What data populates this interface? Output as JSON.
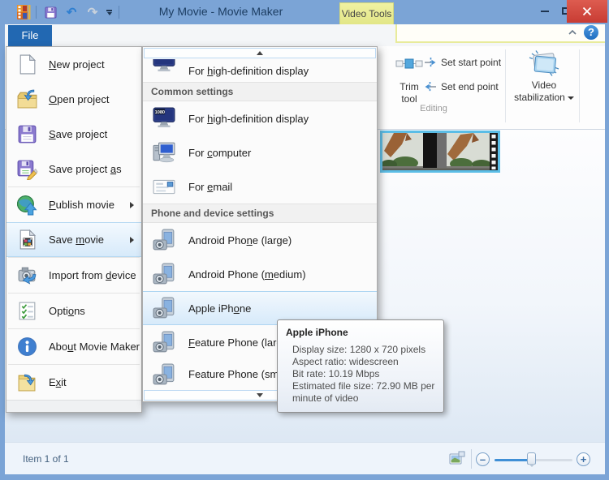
{
  "window": {
    "title": "My Movie - Movie Maker",
    "file_tab": "File",
    "contextual_tab": "Video Tools"
  },
  "icons": {
    "undo": "↶",
    "redo": "↷",
    "help": "?",
    "hd_badge": "1080",
    "zoom_out": "–",
    "zoom_in": "+"
  },
  "ribbon": {
    "trim_tool": "Trim tool",
    "set_start_point": "Set start point",
    "set_end_point": "Set end point",
    "group_editing": "Editing",
    "video_stabilization": "Video stabilization"
  },
  "file_menu": {
    "items": [
      {
        "label": "New project",
        "u": 0
      },
      {
        "label": "Open project",
        "u": 0
      },
      {
        "label": "Save project",
        "u": 0
      },
      {
        "label": "Save project as",
        "u": 13
      },
      {
        "label": "Publish movie",
        "u": 0
      },
      {
        "label": "Save movie",
        "u": 5
      },
      {
        "label": "Import from device",
        "u": 12
      },
      {
        "label": "Options",
        "u": 4
      },
      {
        "label": "About Movie Maker",
        "u": 3
      },
      {
        "label": "Exit",
        "u": 1
      }
    ]
  },
  "save_menu": {
    "partial_item": {
      "label": "For high-definition display",
      "u": 4
    },
    "header_common": "Common settings",
    "common_items": [
      {
        "label": "For high-definition display",
        "u": 4
      },
      {
        "label": "For computer",
        "u": 4
      },
      {
        "label": "For email",
        "u": 4
      }
    ],
    "header_phone": "Phone and device settings",
    "phone_items": [
      {
        "label": "Android Phone (large)",
        "u": 11
      },
      {
        "label": "Android Phone (medium)",
        "u": 15
      },
      {
        "label": "Apple iPhone",
        "u": 9
      },
      {
        "label": "Feature Phone (large)",
        "u": 0
      },
      {
        "label": "Feature Phone (small)",
        "u": 19
      }
    ]
  },
  "tooltip": {
    "title": "Apple iPhone",
    "lines": [
      "Display size: 1280 x 720 pixels",
      "Aspect ratio: widescreen",
      "Bit rate: 10.19 Mbps",
      "Estimated file size: 72.90 MB per minute of video"
    ]
  },
  "status_bar": {
    "items_label": "Item 1 of 1"
  },
  "colors": {
    "titlebar": "#7ba4d6",
    "file_tab": "#2268b2",
    "contextual_tab": "#e7ea93",
    "close_button": "#d4493f",
    "menu_highlight": "#d9eafa",
    "selection_border": "#5bbde6"
  }
}
